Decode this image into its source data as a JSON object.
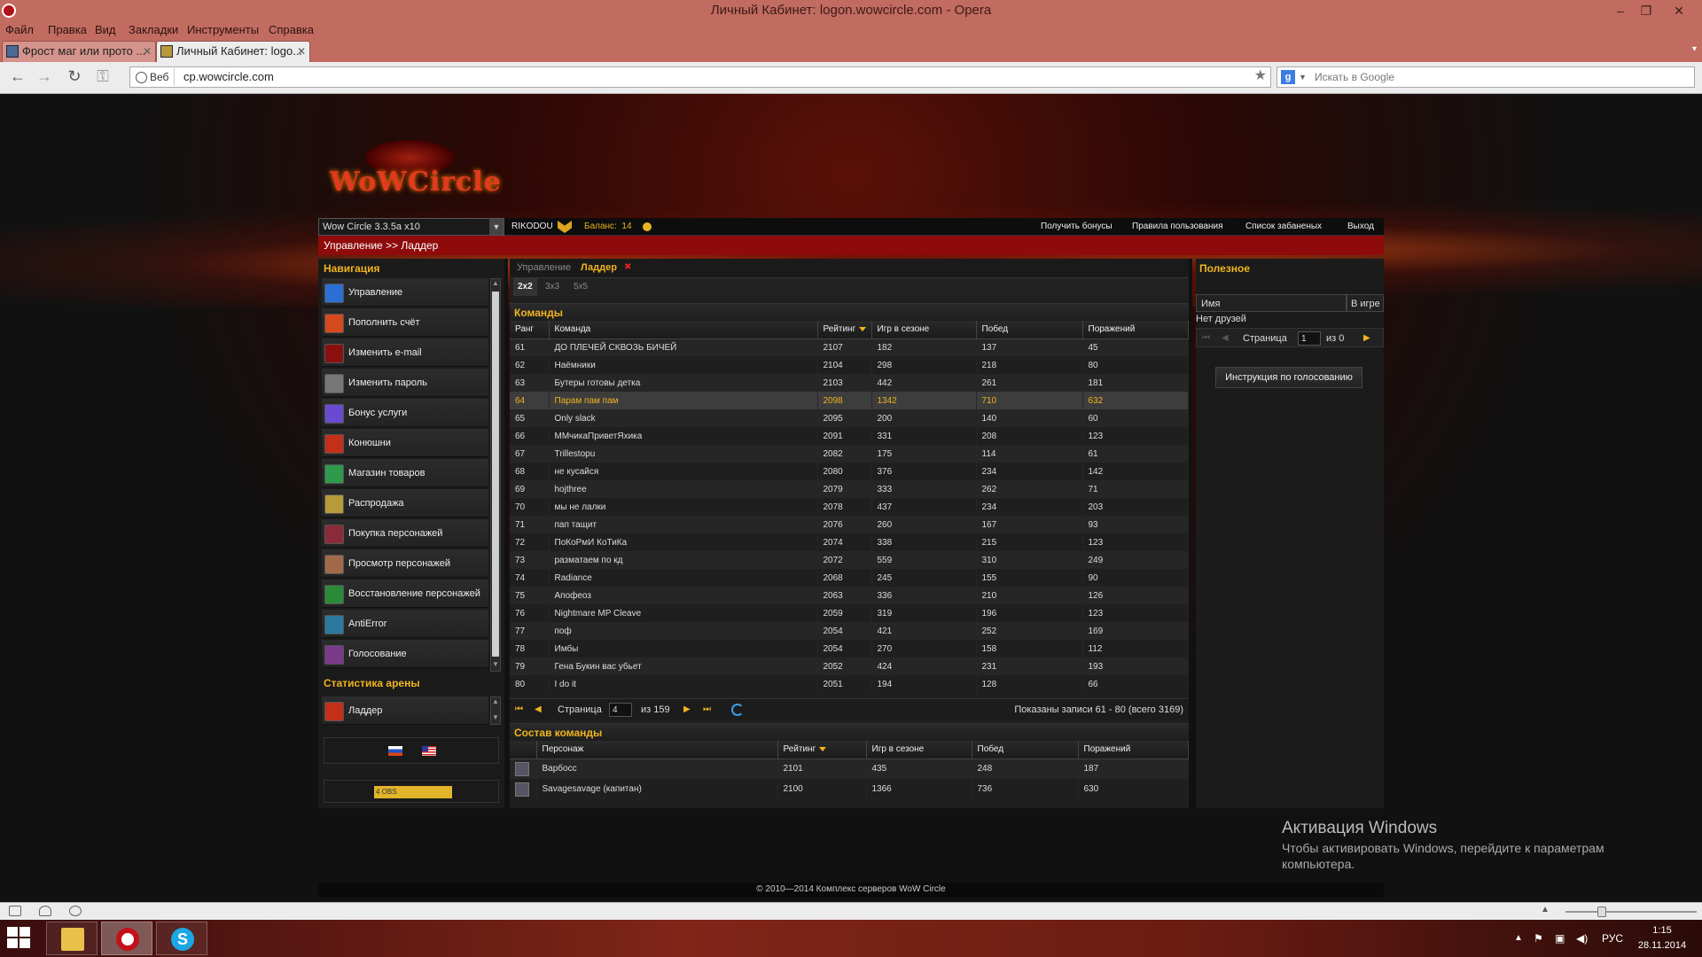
{
  "window": {
    "title": "Личный Кабинет: logon.wowcircle.com - Opera"
  },
  "menu": [
    "Файл",
    "Правка",
    "Вид",
    "Закладки",
    "Инструменты",
    "Справка"
  ],
  "tabs": [
    {
      "label": "Фрост маг или прото ..."
    },
    {
      "label": "Личный Кабинет: logo..."
    }
  ],
  "address": {
    "badge": "Веб",
    "url": "cp.wowcircle.com",
    "search_placeholder": "Искать в Google"
  },
  "site": {
    "logo_text": "WoWCircle",
    "realm_select": "Wow Circle 3.3.5a x10",
    "username": "RIKODOU",
    "balance_label": "Баланс:",
    "balance_value": "14",
    "top_links": [
      "Получить бонусы",
      "Правила пользования",
      "Список забаненых",
      "Выход"
    ],
    "breadcrumb": "Управление >> Ладдер"
  },
  "nav": {
    "title": "Навигация",
    "items": [
      {
        "label": "Управление",
        "color": "#2a6fd6"
      },
      {
        "label": "Пополнить счёт",
        "color": "#d44a1e"
      },
      {
        "label": "Изменить e-mail",
        "color": "#8a1010"
      },
      {
        "label": "Изменить пароль",
        "color": "#777777"
      },
      {
        "label": "Бонус услуги",
        "color": "#6a4ad0"
      },
      {
        "label": "Конюшни",
        "color": "#c3301a"
      },
      {
        "label": "Магазин товаров",
        "color": "#2e9a4c"
      },
      {
        "label": "Распродажа",
        "color": "#b89a3a"
      },
      {
        "label": "Покупка персонажей",
        "color": "#8a2a3a"
      },
      {
        "label": "Просмотр персонажей",
        "color": "#a06a4a"
      },
      {
        "label": "Восстановление персонажей",
        "color": "#2a8a3a"
      },
      {
        "label": "AntiError",
        "color": "#2a7aa0"
      },
      {
        "label": "Голосование",
        "color": "#7a3a8a"
      }
    ],
    "arena_title": "Статистика арены",
    "arena_item": "Ладдер",
    "banner_text": "4 ОВS"
  },
  "content": {
    "tabs": [
      {
        "label": "Управление"
      },
      {
        "label": "Ладдер"
      }
    ],
    "brackets": [
      "2x2",
      "3x3",
      "5x5"
    ],
    "teams_title": "Команды",
    "teams_columns": [
      "Ранг",
      "Команда",
      "Рейтинг",
      "Игр в сезоне",
      "Побед",
      "Поражений"
    ],
    "teams": [
      [
        "61",
        "ДО ПЛЕЧЕЙ СКВОЗЬ БИЧЕЙ",
        "2107",
        "182",
        "137",
        "45"
      ],
      [
        "62",
        "Наёмники",
        "2104",
        "298",
        "218",
        "80"
      ],
      [
        "63",
        "Бутеры готовы детка",
        "2103",
        "442",
        "261",
        "181"
      ],
      [
        "64",
        "Парам пам пам",
        "2098",
        "1342",
        "710",
        "632"
      ],
      [
        "65",
        "Only slack",
        "2095",
        "200",
        "140",
        "60"
      ],
      [
        "66",
        "ММчикаПриветЯхика",
        "2091",
        "331",
        "208",
        "123"
      ],
      [
        "67",
        "Trillestopu",
        "2082",
        "175",
        "114",
        "61"
      ],
      [
        "68",
        "не кусайся",
        "2080",
        "376",
        "234",
        "142"
      ],
      [
        "69",
        "hojthree",
        "2079",
        "333",
        "262",
        "71"
      ],
      [
        "70",
        "мы не лалки",
        "2078",
        "437",
        "234",
        "203"
      ],
      [
        "71",
        "пап тащит",
        "2076",
        "260",
        "167",
        "93"
      ],
      [
        "72",
        "ПоКоРмИ КоТиКа",
        "2074",
        "338",
        "215",
        "123"
      ],
      [
        "73",
        "разматаем по кд",
        "2072",
        "559",
        "310",
        "249"
      ],
      [
        "74",
        "Radiance",
        "2068",
        "245",
        "155",
        "90"
      ],
      [
        "75",
        "Апофеоз",
        "2063",
        "336",
        "210",
        "126"
      ],
      [
        "76",
        "Nightmare MP Cleave",
        "2059",
        "319",
        "196",
        "123"
      ],
      [
        "77",
        "поф",
        "2054",
        "421",
        "252",
        "169"
      ],
      [
        "78",
        "Имбы",
        "2054",
        "270",
        "158",
        "112"
      ],
      [
        "79",
        "Гена Букин вас убьет",
        "2052",
        "424",
        "231",
        "193"
      ],
      [
        "80",
        "I do it",
        "2051",
        "194",
        "128",
        "66"
      ]
    ],
    "highlight_rank": "64",
    "pager": {
      "page_label": "Страница",
      "page_value": "4",
      "of_label": "из 159",
      "summary": "Показаны записи 61 - 80 (всего 3169)"
    },
    "roster_title": "Состав команды",
    "roster_columns": [
      "Персонаж",
      "Рейтинг",
      "Игр в сезоне",
      "Побед",
      "Поражений"
    ],
    "roster": [
      [
        "Варбосс",
        "2101",
        "435",
        "248",
        "187"
      ],
      [
        "Savagesavage (капитан)",
        "2100",
        "1366",
        "736",
        "630"
      ]
    ]
  },
  "sidebar_right": {
    "title": "Полезное",
    "col_name": "Имя",
    "col_ingame": "В игре",
    "empty": "Нет друзей",
    "page_label": "Страница",
    "page_value": "1",
    "of_label": "из 0",
    "vote_button": "Инструкция по голосованию"
  },
  "footer": "© 2010—2014 Комплекс серверов WoW Circle",
  "activation": {
    "title": "Активация Windows",
    "line1": "Чтобы активировать Windows, перейдите к параметрам",
    "line2": "компьютера."
  },
  "taskbar": {
    "lang": "РУС",
    "time": "1:15",
    "date": "28.11.2014"
  }
}
